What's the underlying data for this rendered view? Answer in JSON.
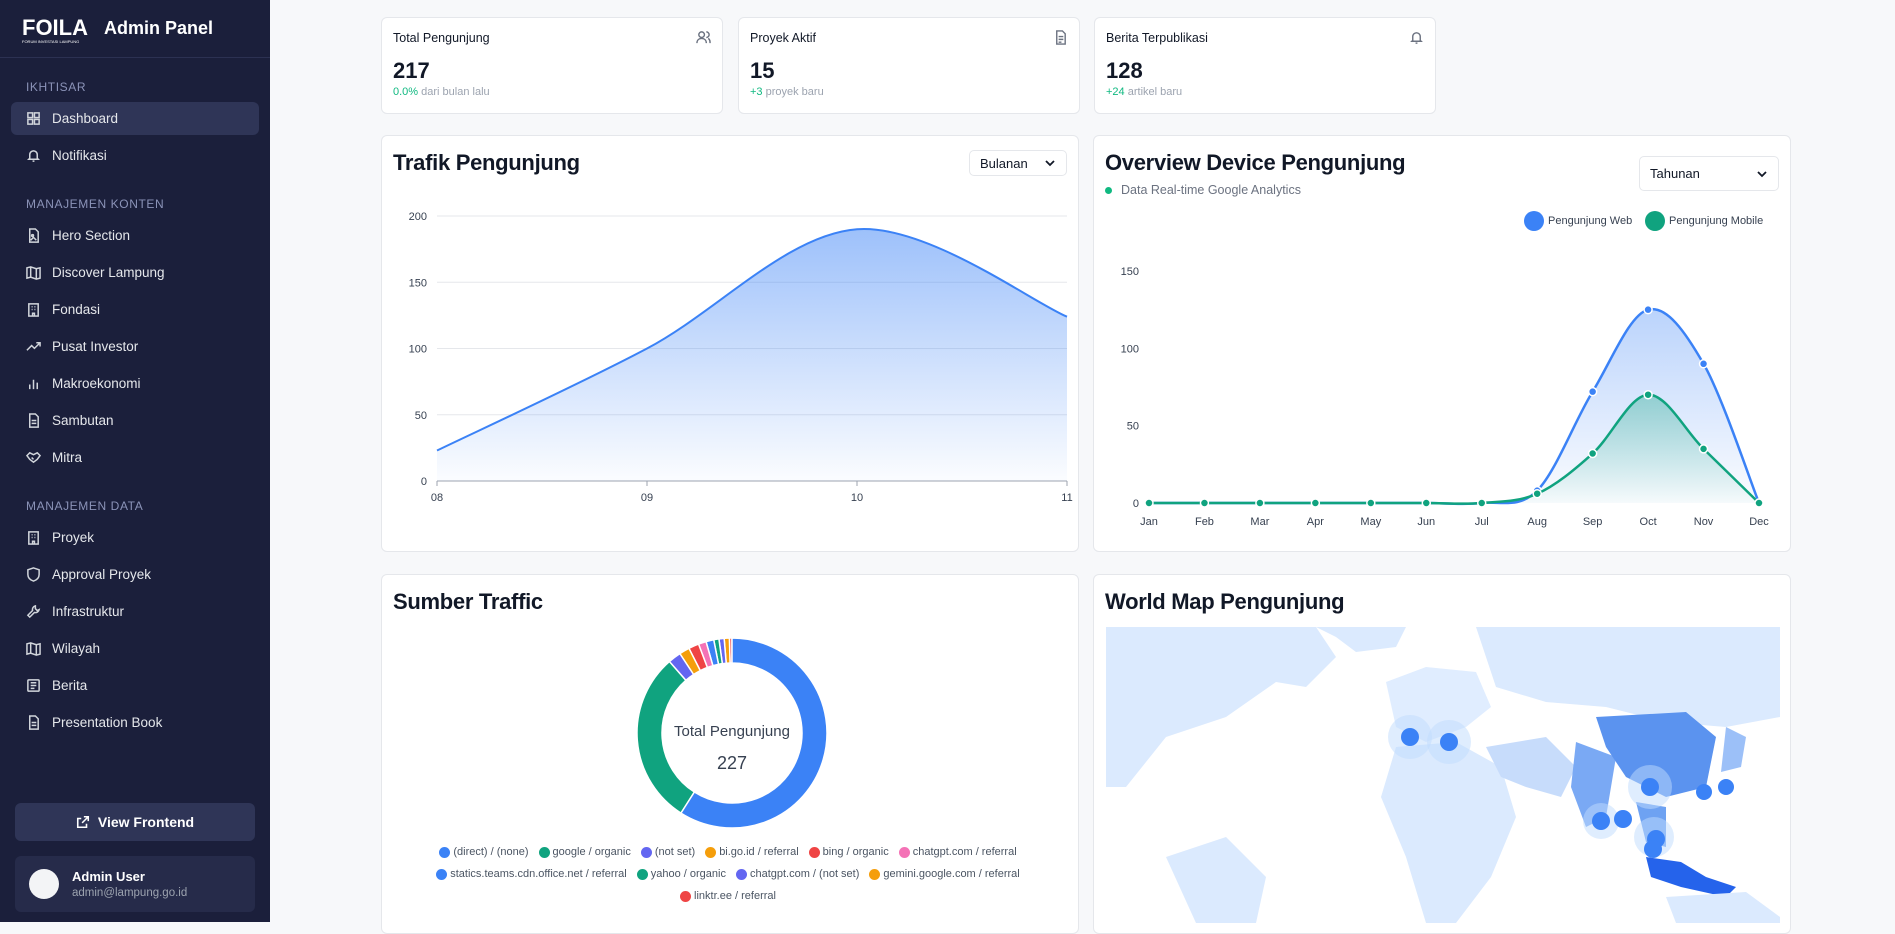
{
  "app": {
    "title": "Admin Panel",
    "logo_text": "FOILA",
    "logo_sub": "FORUM INVESTASI LAMPUNG"
  },
  "sidebar": {
    "sections": [
      {
        "label": "IKHTISAR",
        "items": [
          {
            "label": "Dashboard",
            "icon": "dashboard-icon",
            "active": true
          },
          {
            "label": "Notifikasi",
            "icon": "bell-icon"
          }
        ]
      },
      {
        "label": "MANAJEMEN KONTEN",
        "items": [
          {
            "label": "Hero Section",
            "icon": "image-file-icon"
          },
          {
            "label": "Discover Lampung",
            "icon": "map-icon"
          },
          {
            "label": "Fondasi",
            "icon": "building-icon"
          },
          {
            "label": "Pusat Investor",
            "icon": "trending-up-icon"
          },
          {
            "label": "Makroekonomi",
            "icon": "bar-chart-icon"
          },
          {
            "label": "Sambutan",
            "icon": "document-icon"
          },
          {
            "label": "Mitra",
            "icon": "handshake-icon"
          }
        ]
      },
      {
        "label": "MANAJEMEN DATA",
        "items": [
          {
            "label": "Proyek",
            "icon": "building-icon"
          },
          {
            "label": "Approval Proyek",
            "icon": "shield-icon"
          },
          {
            "label": "Infrastruktur",
            "icon": "wrench-icon"
          },
          {
            "label": "Wilayah",
            "icon": "map-icon"
          },
          {
            "label": "Berita",
            "icon": "newspaper-icon"
          },
          {
            "label": "Presentation Book",
            "icon": "document-icon"
          }
        ]
      }
    ],
    "view_frontend": "View Frontend",
    "user": {
      "name": "Admin User",
      "email": "admin@lampung.go.id"
    }
  },
  "stats": [
    {
      "title": "Total Pengunjung",
      "value": "217",
      "delta": "0.0%",
      "delta_text": " dari bulan lalu",
      "icon": "users-icon"
    },
    {
      "title": "Proyek Aktif",
      "value": "15",
      "delta": "+3",
      "delta_text": " proyek baru",
      "icon": "file-icon"
    },
    {
      "title": "Berita Terpublikasi",
      "value": "128",
      "delta": "+24",
      "delta_text": " artikel baru",
      "icon": "bell-icon"
    }
  ],
  "traffic": {
    "title": "Trafik Pengunjung",
    "period": "Bulanan",
    "chart_data": {
      "type": "area",
      "x": [
        "08",
        "09",
        "10",
        "11"
      ],
      "values": [
        23,
        100,
        190,
        124
      ],
      "ylim": [
        0,
        200
      ],
      "yticks": [
        0,
        50,
        100,
        150,
        200
      ],
      "color": "#3b82f6"
    }
  },
  "device": {
    "title": "Overview Device Pengunjung",
    "subtitle": "Data Real-time Google Analytics",
    "period": "Tahunan",
    "chart_data": {
      "type": "area",
      "categories": [
        "Jan",
        "Feb",
        "Mar",
        "Apr",
        "May",
        "Jun",
        "Jul",
        "Aug",
        "Sep",
        "Oct",
        "Nov",
        "Dec"
      ],
      "series": [
        {
          "name": "Pengunjung Web",
          "values": [
            0,
            0,
            0,
            0,
            0,
            0,
            0,
            8,
            72,
            125,
            90,
            0
          ],
          "color": "#3b82f6"
        },
        {
          "name": "Pengunjung Mobile",
          "values": [
            0,
            0,
            0,
            0,
            0,
            0,
            0,
            6,
            32,
            70,
            35,
            0
          ],
          "color": "#10a37f"
        }
      ],
      "ylim": [
        0,
        150
      ],
      "yticks": [
        0,
        50,
        100,
        150
      ]
    }
  },
  "sources": {
    "title": "Sumber Traffic",
    "center_label": "Total Pengunjung",
    "center_value": "227",
    "chart_data": {
      "type": "pie",
      "labels": [
        "(direct) / (none)",
        "google / organic",
        "(not set)",
        "bi.go.id / referral",
        "bing / organic",
        "chatgpt.com / referral",
        "statics.teams.cdn.office.net / referral",
        "yahoo / organic",
        "chatgpt.com / (not set)",
        "gemini.google.com / referral",
        "linktr.ee / referral"
      ],
      "values": [
        134,
        67,
        5,
        4,
        4,
        3,
        3,
        2,
        2,
        2,
        1
      ],
      "colors": [
        "#3b82f6",
        "#10a37f",
        "#6366f1",
        "#f59e0b",
        "#ef4444",
        "#f472b6",
        "#3b82f6",
        "#10a37f",
        "#6366f1",
        "#f59e0b",
        "#ef4444"
      ]
    }
  },
  "map": {
    "title": "World Map Pengunjung"
  }
}
